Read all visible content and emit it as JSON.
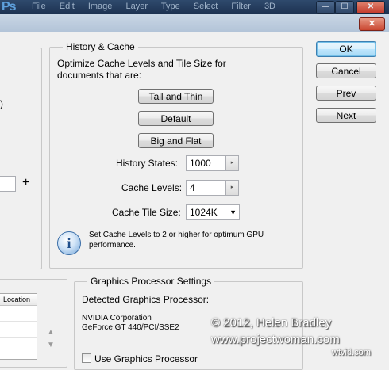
{
  "app": {
    "logo": "Ps",
    "menu": [
      "File",
      "Edit",
      "Image",
      "Layer",
      "Type",
      "Select",
      "Filter",
      "3D"
    ],
    "window_min": "—",
    "window_max": "☐",
    "window_close": "✕",
    "dialog_close": "✕"
  },
  "left_fragments": {
    "paren": ")",
    "plus": "+"
  },
  "history_cache": {
    "title": "History & Cache",
    "description": "Optimize Cache Levels and Tile Size for documents that are:",
    "buttons": [
      "Tall and Thin",
      "Default",
      "Big and Flat"
    ],
    "history_states_label": "History States:",
    "history_states_value": "1000",
    "cache_levels_label": "Cache Levels:",
    "cache_levels_value": "4",
    "tile_size_label": "Cache Tile Size:",
    "tile_size_value": "1024K",
    "info_text": "Set Cache Levels to 2 or higher for optimum GPU performance.",
    "info_glyph": "i"
  },
  "gpu": {
    "title": "Graphics Processor Settings",
    "detected_label": "Detected Graphics Processor:",
    "vendor": "NVIDIA Corporation",
    "model": "GeForce GT 440/PCI/SSE2",
    "use_gpu_label": "Use Graphics Processor"
  },
  "scratch_table": {
    "header": "Location"
  },
  "actions": {
    "ok": "OK",
    "cancel": "Cancel",
    "prev": "Prev",
    "next": "Next"
  },
  "watermark": {
    "line1": "© 2012, Helen Bradley",
    "line2": "www.projectwoman.com",
    "line3": "wtvid.com"
  },
  "icons": {
    "spin": "▸",
    "dropdown": "▼",
    "up": "▲",
    "down": "▼"
  },
  "colors": {
    "default_button": "#bee6fd",
    "titlebar": "#1c3150",
    "close_button": "#c9452f"
  }
}
